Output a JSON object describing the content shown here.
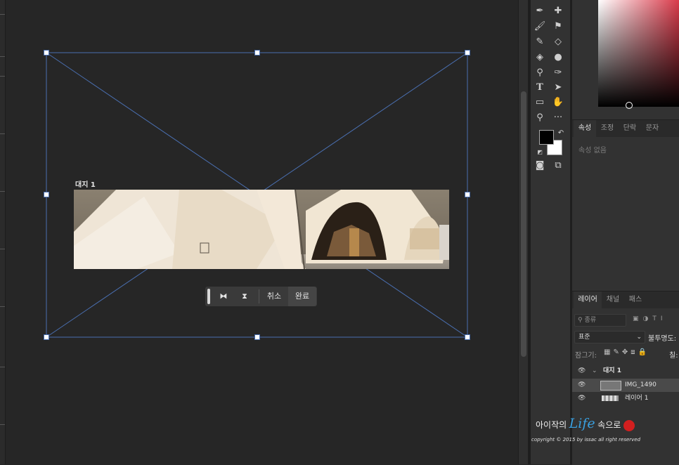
{
  "artboard": {
    "label": "대지 1"
  },
  "transform_bar": {
    "cancel_label": "취소",
    "commit_label": "완료"
  },
  "tools": {
    "icons": [
      "eyedropper-icon",
      "healing-brush-icon",
      "brush-icon",
      "stamp-icon",
      "history-brush-icon",
      "eraser-icon",
      "paint-bucket-icon",
      "blur-icon",
      "dodge-icon",
      "pen-icon",
      "type-icon",
      "path-select-icon",
      "rectangle-icon",
      "hand-icon",
      "zoom-icon",
      "more-icon",
      "quick-mask-icon",
      "screen-mode-icon"
    ],
    "foreground_color": "#000000",
    "background_color": "#ffffff"
  },
  "properties_panel": {
    "tabs": [
      "속성",
      "조정",
      "단락",
      "문자"
    ],
    "empty_label": "속성 없음"
  },
  "layers_panel": {
    "tabs": [
      "레이어",
      "채널",
      "패스"
    ],
    "search_placeholder": "종류",
    "blend_mode": "표준",
    "opacity_label": "불투명도:",
    "lock_label": "잠그기:",
    "fill_label": "칠:",
    "layers": [
      {
        "name": "대지 1",
        "type": "artboard"
      },
      {
        "name": "IMG_1490",
        "type": "smart-object",
        "selected": true
      },
      {
        "name": "레이어 1",
        "type": "pixel"
      }
    ]
  },
  "watermark": {
    "line1_prefix": "아이작의",
    "line1_script": "Life",
    "line1_suffix": "속으로",
    "line2": "copyright © 2015 by issac all right reserved"
  },
  "colors": {
    "accent": "#4a6fb0",
    "panel": "#323232",
    "canvas": "#262626"
  }
}
